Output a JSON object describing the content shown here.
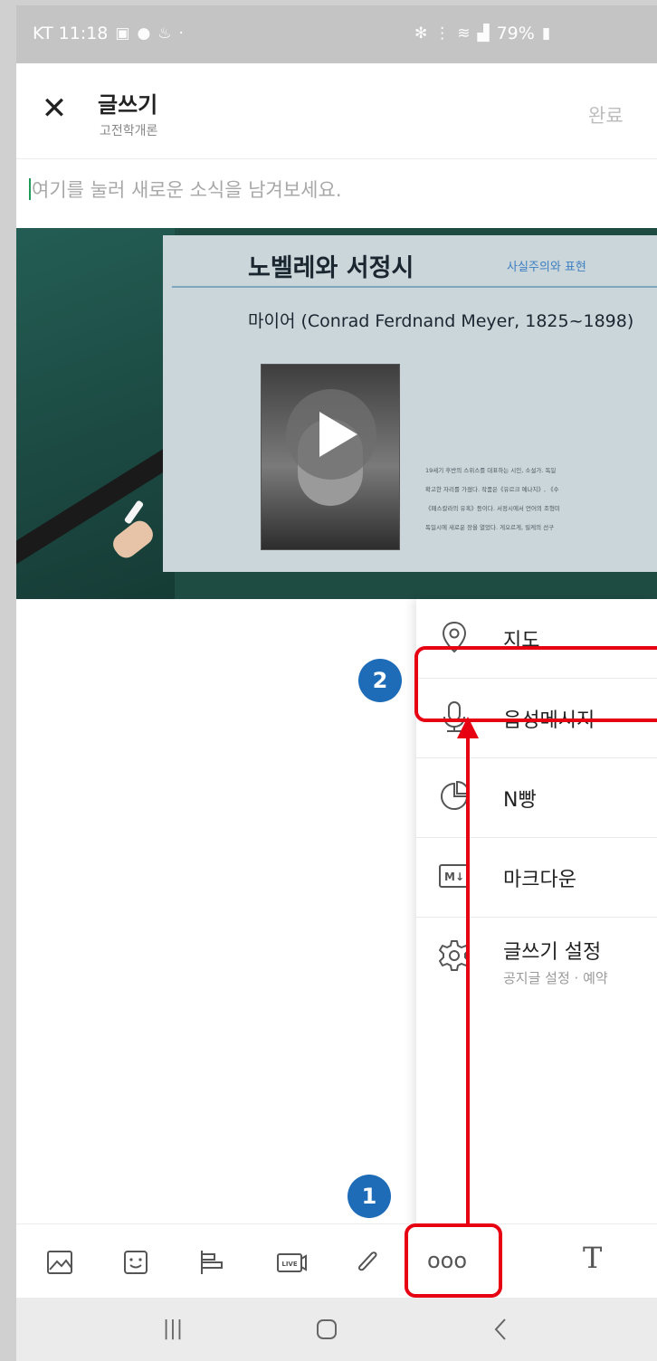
{
  "status_bar": {
    "carrier_time": "KT 11:18",
    "battery": "79%"
  },
  "header": {
    "title": "글쓰기",
    "subtitle": "고전학개론",
    "done_label": "완료"
  },
  "composer": {
    "placeholder": "여기를 눌러 새로운 소식을 남겨보세요."
  },
  "video": {
    "slide_title": "노벨레와 서정시",
    "slide_tag": "사실주의와 표현",
    "slide_subtitle": "마이어 (Conrad Ferdnand Meyer, 1825~1898)",
    "slide_body": [
      "19세기 후반의 스위스를 대표하는 시인, 소설가. 독일",
      "확고한 자리를 가졌다. 작품은《유르크 예나치》, 《수",
      "《페스칼라의 유혹》등이다. 서정시에서 언어의 조형미",
      "독일시에 새로운 장을 열었다. 게오르게, 릴케의 선구"
    ]
  },
  "menu": {
    "items": [
      {
        "label": "지도",
        "icon": "location-pin-icon"
      },
      {
        "label": "음성메시지",
        "icon": "microphone-icon"
      },
      {
        "label": "N빵",
        "icon": "pie-chart-icon"
      },
      {
        "label": "마크다운",
        "icon": "markdown-icon"
      },
      {
        "label": "글쓰기 설정",
        "description": "공지글 설정 · 예약",
        "icon": "gear-icon"
      }
    ]
  },
  "annotations": {
    "badge_1": "1",
    "badge_2": "2",
    "highlight_color": "#e60012",
    "badge_color": "#1e6bb8"
  },
  "toolbar": {
    "items": [
      "image-icon",
      "sticker-icon",
      "poll-icon",
      "live-icon",
      "attachment-icon",
      "more-icon",
      "text-style-icon"
    ],
    "more_label": "ooo",
    "text_label": "T"
  },
  "nav": {
    "recent_label": "|||"
  }
}
